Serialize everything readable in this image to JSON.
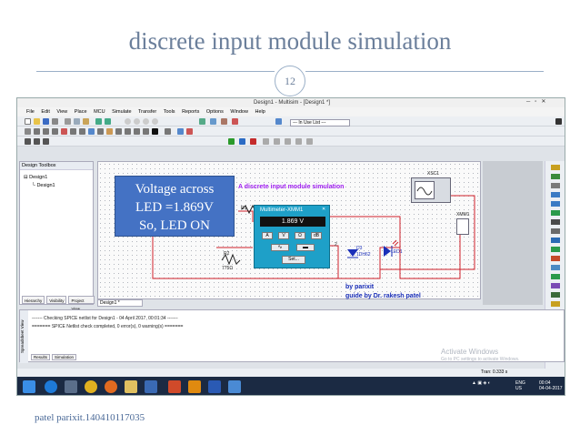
{
  "slide": {
    "title": "discrete input module simulation",
    "page_number": "12",
    "footer": "patel parixit.140410117035"
  },
  "app": {
    "window_title": "Design1 - Multisim - [Design1 *]",
    "menus": [
      "File",
      "Edit",
      "View",
      "Place",
      "MCU",
      "Simulate",
      "Transfer",
      "Tools",
      "Reports",
      "Options",
      "Window",
      "Help"
    ],
    "in_use_list": "--- In Use List ---",
    "design_toolbox": {
      "title": "Design Toolbox",
      "root": "Design1",
      "child": "Design1",
      "tabs": [
        "Hierarchy",
        "Visibility",
        "Project View"
      ]
    },
    "canvas_tab": "Design1 *",
    "spreadsheet": {
      "side_label": "Spreadsheet View",
      "line1": "------- Checking SPICE netlist for Design1 - 04 April 2017, 00:01:34 -------",
      "line2": "======= SPICE Netlist check completed, 0 error(s), 0 warning(s) =======",
      "tabs": [
        "Results",
        "Simulation"
      ]
    },
    "activate": {
      "title": "Activate Windows",
      "sub": "Go to PC settings to activate Windows."
    },
    "status": {
      "tran": "Tran: 0.333 s"
    },
    "tray": {
      "lang": "ENG",
      "region": "US",
      "time": "00:04",
      "date": "04-04-2017"
    }
  },
  "circuit": {
    "title": "A discrete input module simulation",
    "oscilloscope": "XSC1",
    "multimeter_ref": "XMM1",
    "r1": "R1",
    "r2": "R2",
    "r2_value": "775Ω",
    "d3": "D3",
    "d3_part": "1DH62",
    "led": "LED1",
    "author1": "by parixit",
    "author2": "guide by Dr. rakesh patel"
  },
  "callout": {
    "line1": "Voltage across",
    "line2": "LED =1.869V",
    "line3": "So, LED ON"
  },
  "multimeter": {
    "title": "Multimeter-XMM1",
    "reading": "1.869 V",
    "buttons": [
      "A",
      "V",
      "Ω",
      "dB"
    ],
    "set_label": "Set..."
  }
}
